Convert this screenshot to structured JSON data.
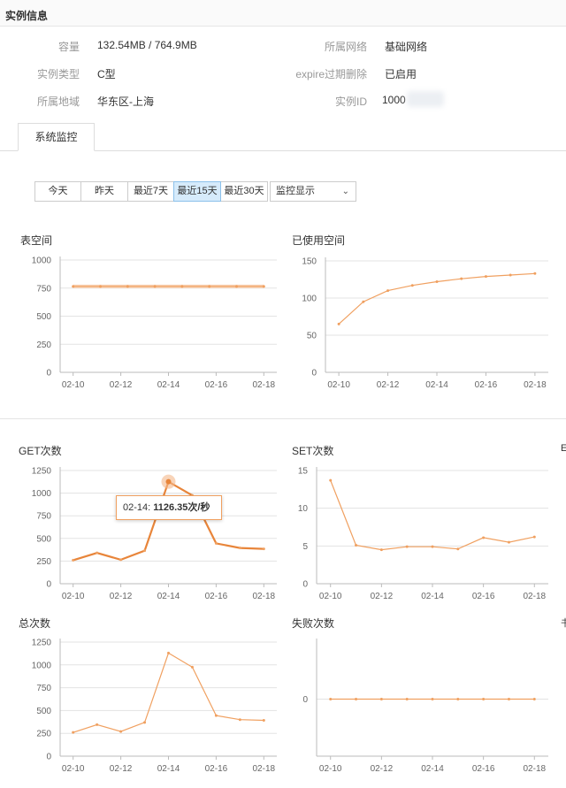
{
  "section_title": "实例信息",
  "info": {
    "capacity_label": "容量",
    "capacity_value": "132.54MB / 764.9MB",
    "type_label": "实例类型",
    "type_value": "C型",
    "region_label": "所属地域",
    "region_value": "华东区-上海",
    "network_label": "所属网络",
    "network_value": "基础网络",
    "expire_label": "expire过期删除",
    "expire_value": "已启用",
    "id_label": "实例ID",
    "id_value": "1000"
  },
  "tab": "系统监控",
  "range_buttons": [
    "今天",
    "昨天",
    "最近7天",
    "最近15天",
    "最近30天"
  ],
  "active_range": "最近15天",
  "select": {
    "value": "监控显示"
  },
  "tooltip": {
    "date": "02-14:",
    "value": "1126.35次/秒"
  },
  "edge_glyphs": [
    "E",
    "书"
  ],
  "x_ticks": [
    "02-10",
    "02-12",
    "02-14",
    "02-16",
    "02-18"
  ],
  "colors": {
    "line": "#f0a060",
    "line_strong": "#e8853a",
    "grid": "#e3e3e3",
    "axis": "#bbb"
  },
  "chart_data": [
    {
      "type": "area",
      "title": "表空间",
      "ylim": [
        0,
        1000
      ],
      "y_ticks": [
        0,
        250,
        500,
        750,
        1000
      ],
      "x": [
        "02-10",
        "02-11",
        "02-12",
        "02-13",
        "02-14",
        "02-15",
        "02-16",
        "02-17",
        "02-18"
      ],
      "values": [
        765,
        765,
        765,
        765,
        765,
        765,
        765,
        765
      ]
    },
    {
      "type": "line",
      "title": "已使用空间",
      "ylim": [
        0,
        150
      ],
      "y_ticks": [
        0,
        50,
        100,
        150
      ],
      "x": [
        "02-10",
        "02-11",
        "02-12",
        "02-13",
        "02-14",
        "02-15",
        "02-16",
        "02-17",
        "02-18"
      ],
      "values": [
        65,
        95,
        110,
        117,
        122,
        126,
        129,
        131,
        133
      ]
    },
    {
      "type": "line",
      "title": "GET次数",
      "ylim": [
        0,
        1250
      ],
      "y_ticks": [
        0,
        250,
        500,
        750,
        1000,
        1250
      ],
      "x": [
        "02-10",
        "02-11",
        "02-12",
        "02-13",
        "02-14",
        "02-15",
        "02-16",
        "02-17",
        "02-18"
      ],
      "values": [
        260,
        340,
        265,
        365,
        1126.35,
        975,
        445,
        395,
        385
      ]
    },
    {
      "type": "line",
      "title": "SET次数",
      "ylim": [
        0,
        15
      ],
      "y_ticks": [
        0,
        5,
        10,
        15
      ],
      "x": [
        "02-10",
        "02-11",
        "02-12",
        "02-13",
        "02-14",
        "02-15",
        "02-16",
        "02-17",
        "02-18"
      ],
      "values": [
        13.7,
        5.1,
        4.5,
        4.9,
        4.9,
        4.6,
        6.1,
        5.5,
        6.2
      ]
    },
    {
      "type": "line",
      "title": "总次数",
      "ylim": [
        0,
        1250
      ],
      "y_ticks": [
        0,
        250,
        500,
        750,
        1000,
        1250
      ],
      "x": [
        "02-10",
        "02-11",
        "02-12",
        "02-13",
        "02-14",
        "02-15",
        "02-16",
        "02-17",
        "02-18"
      ],
      "values": [
        260,
        345,
        270,
        370,
        1130,
        975,
        445,
        400,
        392
      ]
    },
    {
      "type": "line",
      "title": "失败次数",
      "ylim": [
        -1,
        1
      ],
      "y_ticks": [
        0
      ],
      "x": [
        "02-10",
        "02-11",
        "02-12",
        "02-13",
        "02-14",
        "02-15",
        "02-16",
        "02-17",
        "02-18"
      ],
      "values": [
        0,
        0,
        0,
        0,
        0,
        0,
        0,
        0,
        0
      ]
    }
  ]
}
